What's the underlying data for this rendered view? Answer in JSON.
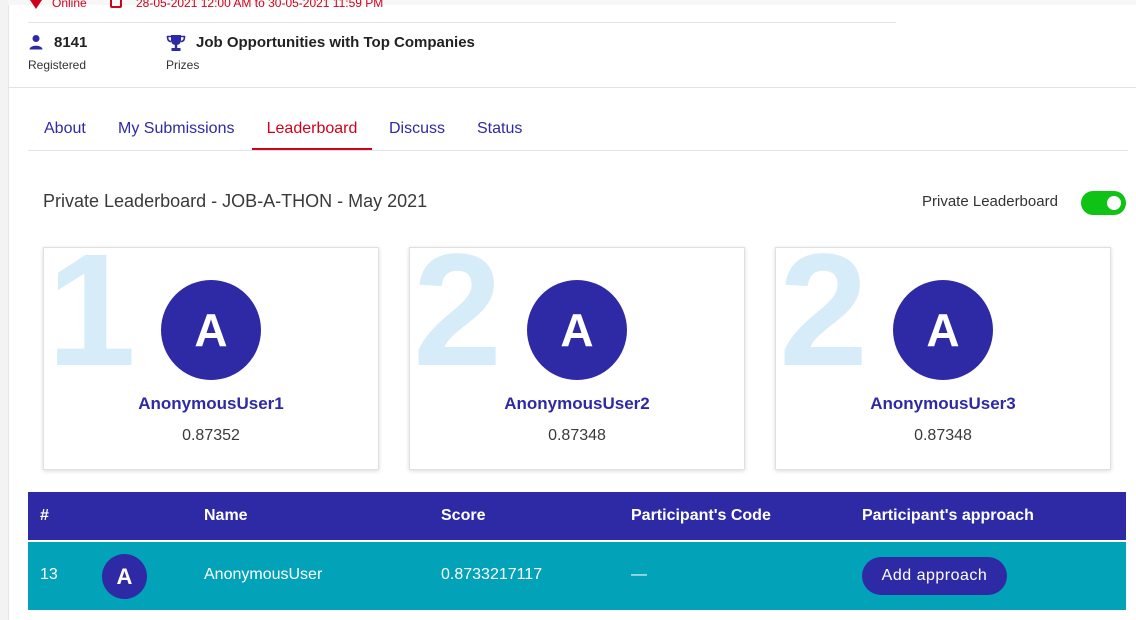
{
  "event": {
    "mode": "Online",
    "dates": "28-05-2021 12:00 AM to 30-05-2021 11:59 PM",
    "registered_count": "8141",
    "registered_label": "Registered",
    "prize_text": "Job Opportunities with Top Companies",
    "prize_label": "Prizes"
  },
  "tabs": [
    {
      "label": "About"
    },
    {
      "label": "My Submissions"
    },
    {
      "label": "Leaderboard",
      "active": true
    },
    {
      "label": "Discuss"
    },
    {
      "label": "Status"
    }
  ],
  "leaderboard": {
    "title": "Private Leaderboard - JOB-A-THON - May 2021",
    "toggle_label": "Private Leaderboard",
    "toggle_on": true
  },
  "podium": [
    {
      "rank": "1",
      "initial": "A",
      "name": "AnonymousUser1",
      "score": "0.87352"
    },
    {
      "rank": "2",
      "initial": "A",
      "name": "AnonymousUser2",
      "score": "0.87348"
    },
    {
      "rank": "2",
      "initial": "A",
      "name": "AnonymousUser3",
      "score": "0.87348"
    }
  ],
  "table": {
    "headers": [
      "#",
      "Name",
      "Score",
      "Participant's Code",
      "Participant's approach"
    ],
    "rows": [
      {
        "rank": "13",
        "initial": "A",
        "name": "AnonymousUser",
        "score": "0.8733217117",
        "code": "—",
        "approach_button": "Add approach"
      }
    ]
  },
  "colors": {
    "primary": "#2e2aa5",
    "accent_red": "#d0021b",
    "row_highlight": "#02a2b8",
    "toggle_on": "#0ec316",
    "rank_watermark": "#d6ecf8"
  }
}
